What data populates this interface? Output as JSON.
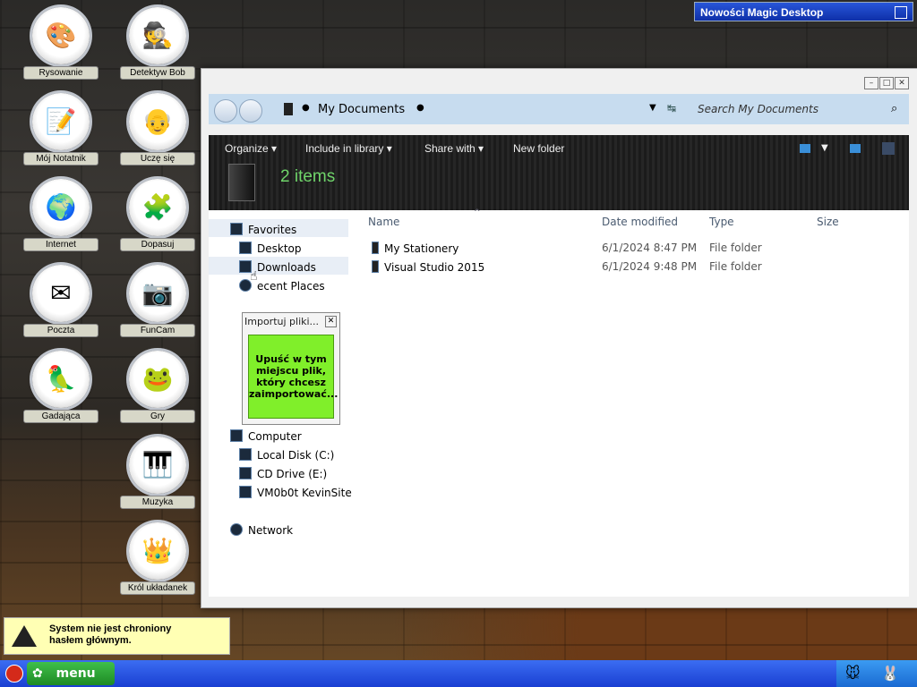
{
  "banner": {
    "title": "Nowości Magic Desktop"
  },
  "desktop_icons": [
    {
      "label": "Rysowanie",
      "icon": "paint-palette-icon"
    },
    {
      "label": "Detektyw Bob",
      "icon": "detective-icon"
    },
    {
      "label": "Mój Notatnik",
      "icon": "notebook-icon"
    },
    {
      "label": "Uczę się",
      "icon": "teacher-icon"
    },
    {
      "label": "Internet",
      "icon": "globe-icon"
    },
    {
      "label": "Dopasuj",
      "icon": "puzzle-icon"
    },
    {
      "label": "Poczta",
      "icon": "mail-icon"
    },
    {
      "label": "FunCam",
      "icon": "webcam-icon"
    },
    {
      "label": "Gadająca",
      "icon": "parrot-icon"
    },
    {
      "label": "Gry",
      "icon": "frog-icon"
    },
    {
      "label": "Muzyka",
      "icon": "keyboard-icon"
    },
    {
      "label": "Król układanek",
      "icon": "puzzle-king-icon"
    }
  ],
  "explorer": {
    "breadcrumb": "My Documents",
    "search_placeholder": "Search My Documents",
    "toolbar": {
      "organize": "Organize",
      "include": "Include in library",
      "share": "Share with",
      "new_folder": "New folder"
    },
    "item_count": "2 items",
    "columns": {
      "name": "Name",
      "date": "Date modified",
      "type": "Type",
      "size": "Size"
    },
    "files": [
      {
        "name": "My Stationery",
        "date": "6/1/2024 8:47 PM",
        "type": "File folder"
      },
      {
        "name": "Visual Studio 2015",
        "date": "6/1/2024 9:48 PM",
        "type": "File folder"
      }
    ],
    "nav": {
      "favorites": "Favorites",
      "desktop": "Desktop",
      "downloads": "Downloads",
      "recent": "ecent Places",
      "computer": "Computer",
      "local_disk": "Local Disk (C:)",
      "cd_drive": "CD Drive (E:)",
      "vm": "VM0b0t KevinSite",
      "network": "Network"
    }
  },
  "import_widget": {
    "title": "Importuj pliki...",
    "text": "Upuść w tym miejscu plik, który chcesz zaimportować..."
  },
  "warning": {
    "line1": "System nie jest chroniony",
    "line2": "hasłem głównym."
  },
  "taskbar": {
    "menu_label": "menu"
  }
}
